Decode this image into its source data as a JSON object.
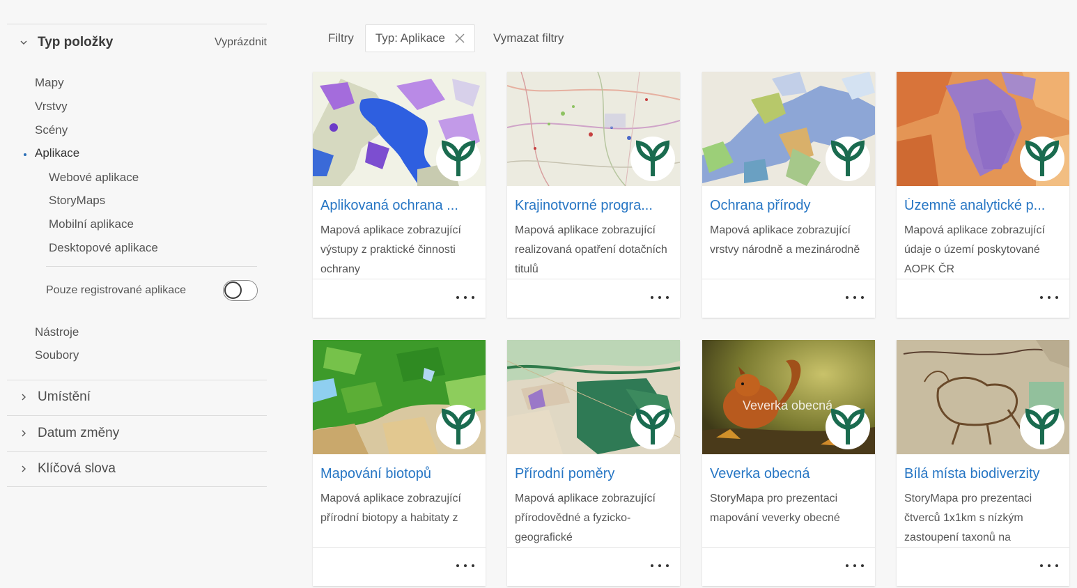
{
  "sidebar": {
    "type_facet": {
      "title": "Typ položky",
      "clear_label": "Vyprázdnit",
      "items": [
        "Mapy",
        "Vrstvy",
        "Scény",
        "Aplikace"
      ],
      "app_subitems": [
        "Webové aplikace",
        "StoryMaps",
        "Mobilní aplikace",
        "Desktopové aplikace"
      ],
      "registered_toggle_label": "Pouze registrované aplikace",
      "registered_toggle_on": false,
      "more_items": [
        "Nástroje",
        "Soubory"
      ],
      "active_item": "Aplikace"
    },
    "collapsed_facets": [
      "Umístění",
      "Datum změny",
      "Klíčová slova"
    ]
  },
  "filters": {
    "label": "Filtry",
    "chip_label": "Typ: Aplikace",
    "clear_label": "Vymazat filtry"
  },
  "cards": [
    {
      "title": "Aplikovaná ochrana ...",
      "desc": "Mapová aplikace zobrazující výstupy z praktické činnosti ochrany"
    },
    {
      "title": "Krajinotvorné progra...",
      "desc": "Mapová aplikace zobrazující realizovaná opatření dotačních titulů"
    },
    {
      "title": "Ochrana přírody",
      "desc": "Mapová aplikace zobrazující vrstvy národně a mezinárodně"
    },
    {
      "title": "Územně analytické p...",
      "desc": "Mapová aplikace zobrazující údaje o území poskytované AOPK ČR"
    },
    {
      "title": "Mapování biotopů",
      "desc": "Mapová aplikace zobrazující přírodní biotopy a habitaty z"
    },
    {
      "title": "Přírodní poměry",
      "desc": "Mapová aplikace zobrazující přírodovědné a fyzicko-geografické"
    },
    {
      "title": "Veverka obecná",
      "desc": "StoryMapa pro prezentaci mapování veverky obecné",
      "thumb_caption": "Veverka obecná"
    },
    {
      "title": "Bílá místa biodiverzity",
      "desc": "StoryMapa pro prezentaci čtverců 1x1km s nízkým zastoupení taxonů na"
    }
  ],
  "colors": {
    "link_blue": "#2776c4",
    "logo_green": "#1a6b4f",
    "active_bullet": "#2b6fb6"
  },
  "icons": {
    "collapse": "chevron-down-icon",
    "expand": "chevron-right-icon",
    "remove_filter": "close-icon",
    "card_menu": "more-options-icon",
    "brand": "aopk-leaf-logo-icon"
  }
}
